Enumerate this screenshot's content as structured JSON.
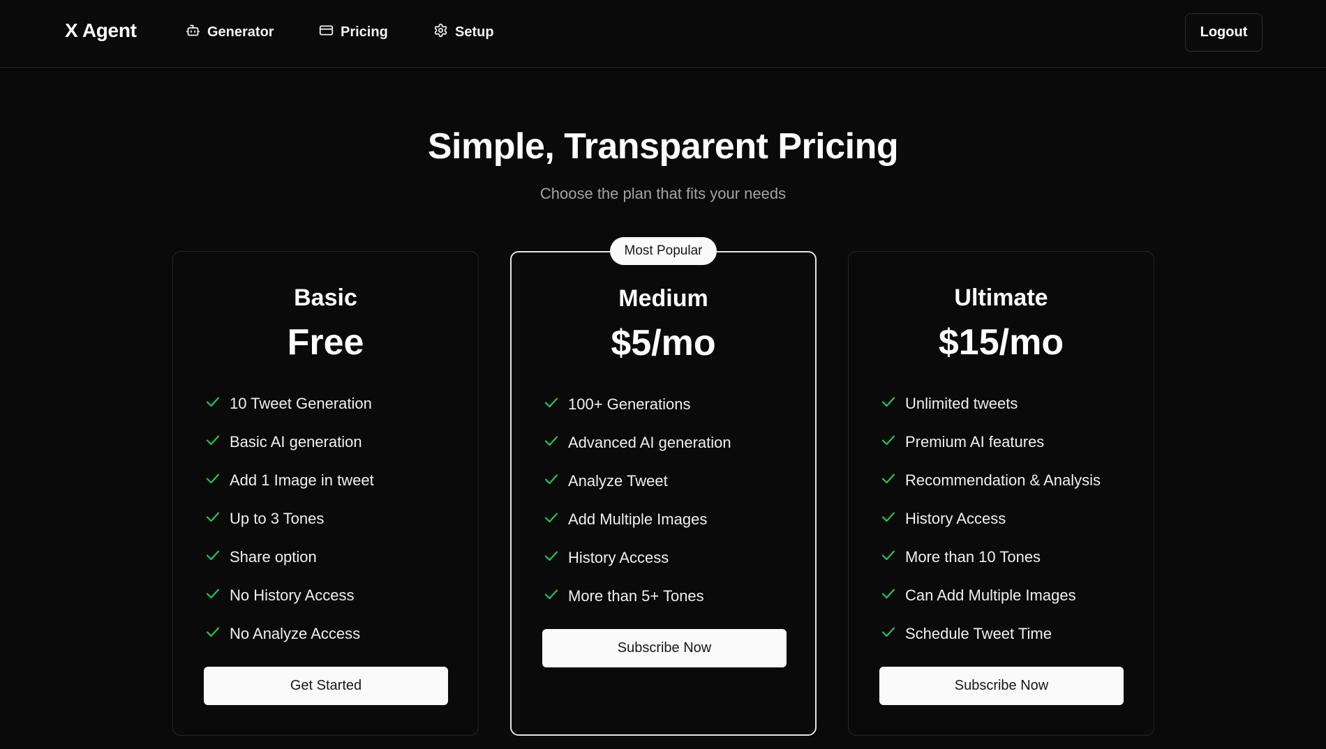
{
  "header": {
    "brand": "X Agent",
    "nav": [
      {
        "label": "Generator",
        "icon": "bot-icon"
      },
      {
        "label": "Pricing",
        "icon": "credit-card-icon"
      },
      {
        "label": "Setup",
        "icon": "gear-icon"
      }
    ],
    "logout_label": "Logout"
  },
  "hero": {
    "title": "Simple, Transparent Pricing",
    "subtitle": "Choose the plan that fits your needs"
  },
  "colors": {
    "background": "#0a0a0a",
    "check": "#22c55e",
    "button_bg": "#fafafa",
    "border": "#262626"
  },
  "plans": [
    {
      "name": "Basic",
      "price": "Free",
      "features": [
        "10 Tweet Generation",
        "Basic AI generation",
        "Add 1 Image in tweet",
        "Up to 3 Tones",
        "Share option",
        "No History Access",
        "No Analyze Access"
      ],
      "button_label": "Get Started"
    },
    {
      "name": "Medium",
      "price": "$5/mo",
      "badge": "Most Popular",
      "features": [
        "100+ Generations",
        "Advanced AI generation",
        "Analyze Tweet",
        "Add Multiple Images",
        "History Access",
        "More than 5+ Tones"
      ],
      "button_label": "Subscribe Now"
    },
    {
      "name": "Ultimate",
      "price": "$15/mo",
      "features": [
        "Unlimited tweets",
        "Premium AI features",
        "Recommendation & Analysis",
        "History Access",
        "More than 10 Tones",
        "Can Add Multiple Images",
        "Schedule Tweet Time"
      ],
      "button_label": "Subscribe Now"
    }
  ]
}
